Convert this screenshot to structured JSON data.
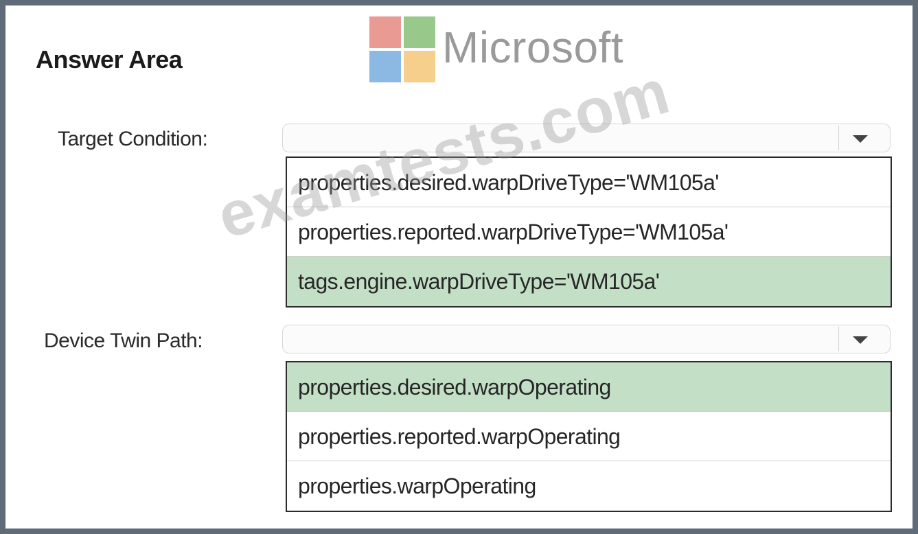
{
  "answer_area": {
    "title": "Answer Area"
  },
  "logo": {
    "wordmark": "Microsoft",
    "colors": {
      "red": "#e89a93",
      "green": "#98c88a",
      "blue": "#8bb9e3",
      "yellow": "#f6cf8c"
    }
  },
  "target_condition": {
    "label": "Target Condition:",
    "selected_value": "",
    "options": [
      {
        "label": "properties.desired.warpDriveType='WM105a'",
        "selected": false
      },
      {
        "label": "properties.reported.warpDriveType='WM105a'",
        "selected": false
      },
      {
        "label": "tags.engine.warpDriveType='WM105a'",
        "selected": true
      }
    ]
  },
  "device_twin_path": {
    "label": "Device Twin Path:",
    "selected_value": "",
    "options": [
      {
        "label": "properties.desired.warpOperating",
        "selected": true
      },
      {
        "label": "properties.reported.warpOperating",
        "selected": false
      },
      {
        "label": "properties.warpOperating",
        "selected": false
      }
    ]
  },
  "watermark": "examtests.com",
  "colors": {
    "selected_option_bg": "#c3e0c6",
    "frame_border": "#5f6b78"
  }
}
